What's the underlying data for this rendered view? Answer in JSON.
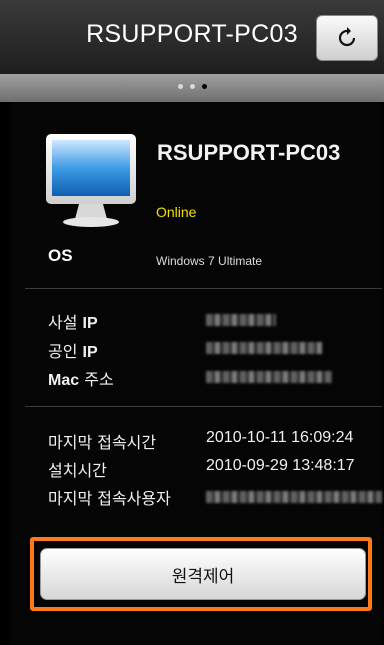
{
  "header": {
    "title": "RSUPPORT-PC03",
    "refresh_icon": "refresh-icon"
  },
  "pager": {
    "page_count": 3,
    "active_index": 2
  },
  "device": {
    "name": "RSUPPORT-PC03",
    "status": "Online",
    "status_color": "#f4e100",
    "icon": "monitor-icon"
  },
  "os": {
    "label": "OS",
    "value": "Windows 7 Ultimate"
  },
  "network": {
    "private_ip_label_prefix": "사설",
    "private_ip_label_suffix": "IP",
    "public_ip_label_prefix": "공인",
    "public_ip_label_suffix": "IP",
    "mac_label_prefix": "Mac",
    "mac_label_suffix": "주소"
  },
  "history": {
    "last_access_label": "마지막 접속시간",
    "last_access_value": "2010-10-11 16:09:24",
    "install_label": "설치시간",
    "install_value": "2010-09-29 13:48:17",
    "last_user_label": "마지막 접속사용자"
  },
  "actions": {
    "remote_control_label": "원격제어",
    "highlight_color": "#ff7a1a"
  }
}
